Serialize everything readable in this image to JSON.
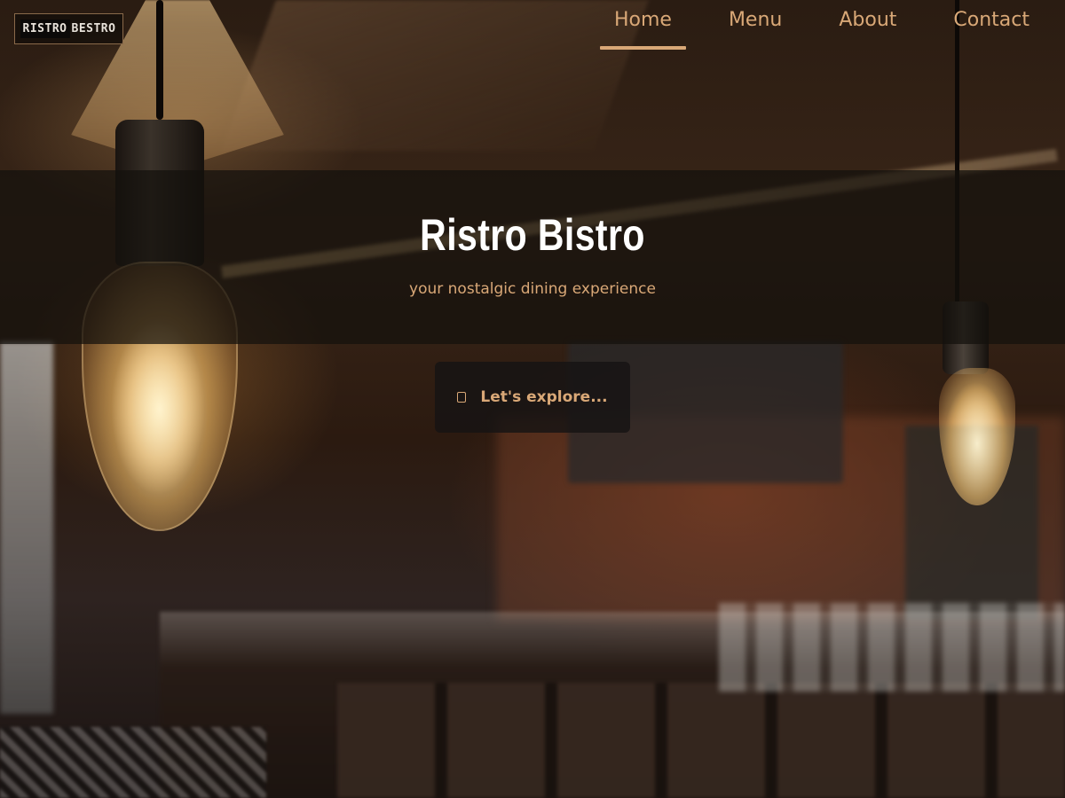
{
  "logo": {
    "part1": "RISTRO",
    "part2": "BESTRO"
  },
  "nav": {
    "items": [
      {
        "label": "Home",
        "active": true
      },
      {
        "label": "Menu",
        "active": false
      },
      {
        "label": "About",
        "active": false
      },
      {
        "label": "Contact",
        "active": false
      }
    ]
  },
  "hero": {
    "title": "Ristro Bistro",
    "subtitle": "your nostalgic dining experience",
    "cta_label": "Let's explore...",
    "cta_icon": "box-icon"
  },
  "colors": {
    "accent": "#d9a877",
    "banner_bg": "#14100d",
    "title": "#ffffff"
  }
}
